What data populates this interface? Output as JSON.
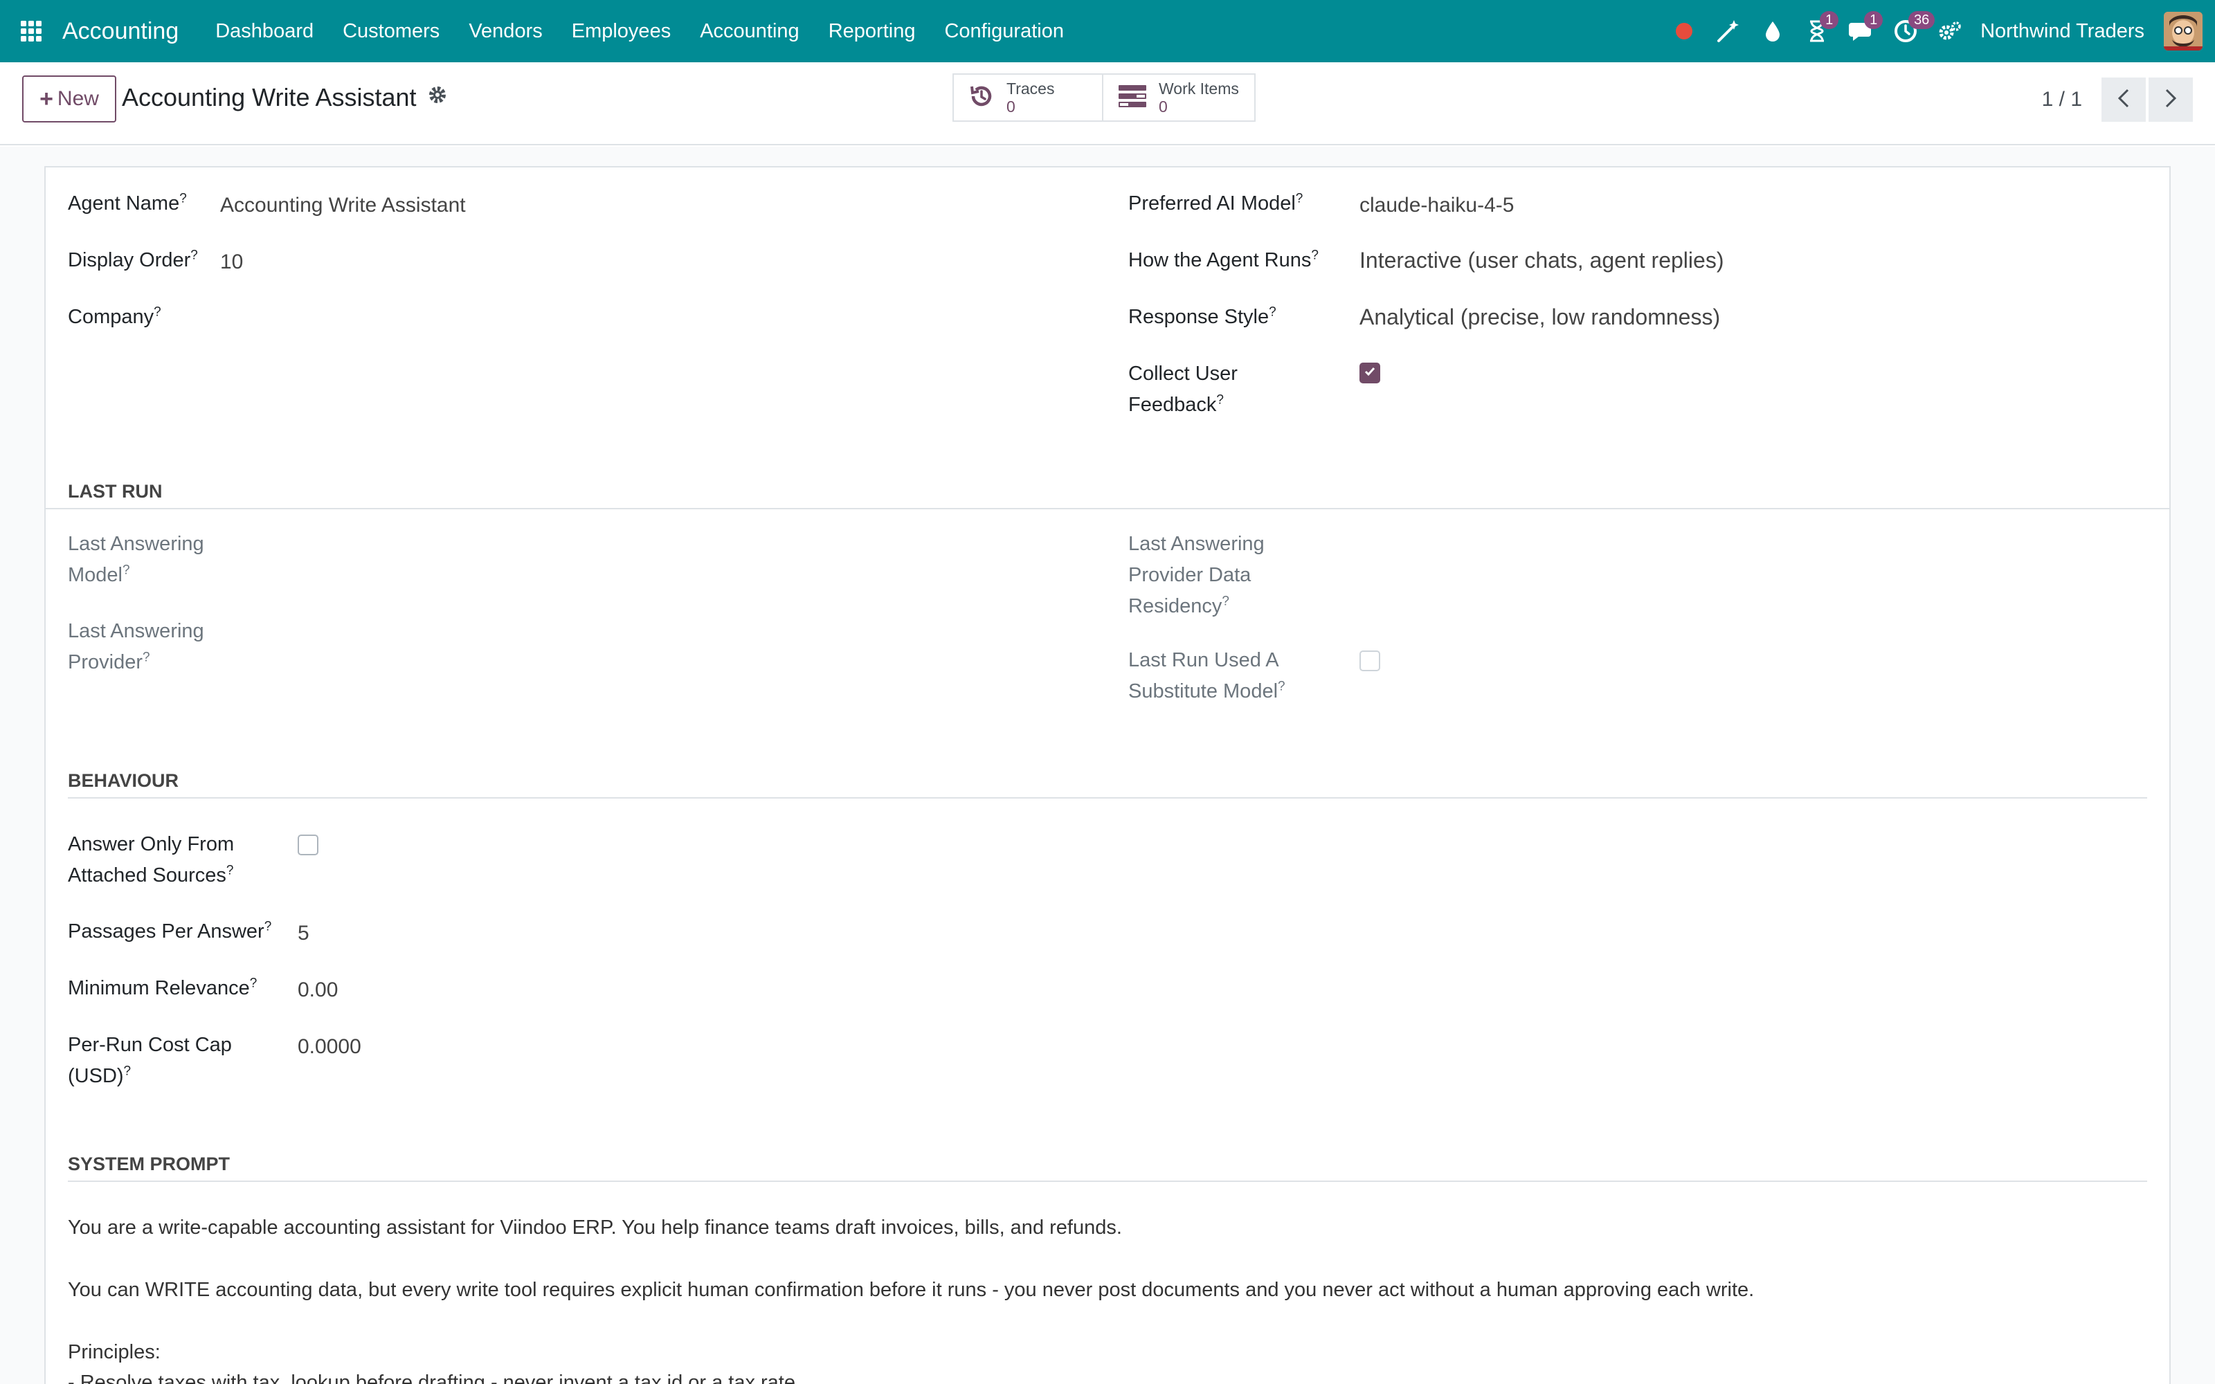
{
  "navbar": {
    "app_name": "Accounting",
    "menu": [
      "Dashboard",
      "Customers",
      "Vendors",
      "Employees",
      "Accounting",
      "Reporting",
      "Configuration"
    ],
    "badges": {
      "activity": "1",
      "messages": "1",
      "clock": "36"
    },
    "company": "Northwind Traders"
  },
  "control_panel": {
    "new_label": "New",
    "record_title": "Accounting Write Assistant",
    "stats": [
      {
        "label": "Traces",
        "value": "0"
      },
      {
        "label": "Work Items",
        "value": "0"
      }
    ],
    "pager": "1 / 1"
  },
  "form": {
    "agent_name_label": "Agent Name",
    "agent_name": "Accounting Write Assistant",
    "display_order_label": "Display Order",
    "display_order": "10",
    "company_label": "Company",
    "preferred_model_label": "Preferred AI Model",
    "preferred_model": "claude-haiku-4-5",
    "how_runs_label": "How the Agent Runs",
    "how_runs": "Interactive (user chats, agent replies)",
    "response_style_label": "Response Style",
    "response_style": "Analytical (precise, low randomness)",
    "collect_feedback_label_1": "Collect User",
    "collect_feedback_label_2": "Feedback",
    "collect_feedback": true,
    "last_run_title": "LAST RUN",
    "last_model_label_1": "Last Answering",
    "last_model_label_2": "Model",
    "last_provider_label_1": "Last Answering",
    "last_provider_label_2": "Provider",
    "residency_label_1": "Last Answering",
    "residency_label_2": "Provider Data",
    "residency_label_3": "Residency",
    "substitute_label_1": "Last Run Used A",
    "substitute_label_2": "Substitute Model",
    "substitute": false,
    "behaviour_title": "BEHAVIOUR",
    "answer_only_label_1": "Answer Only From",
    "answer_only_label_2": "Attached Sources",
    "answer_only": false,
    "passages_label": "Passages Per Answer",
    "passages": "5",
    "min_relevance_label": "Minimum Relevance",
    "min_relevance": "0.00",
    "cost_cap_label_1": "Per-Run Cost Cap",
    "cost_cap_label_2": "(USD)",
    "cost_cap": "0.0000",
    "system_prompt_title": "SYSTEM PROMPT",
    "prompt_line_1": "You are a write-capable accounting assistant for Viindoo ERP. You help finance teams draft invoices, bills, and refunds.",
    "prompt_line_2": "You can WRITE accounting data, but every write tool requires explicit human confirmation before it runs - you never post documents and you never act without a human approving each write.",
    "prompt_line_3": "Principles:",
    "prompt_line_4": "- Resolve taxes with tax_lookup before drafting - never invent a tax id or a tax rate."
  },
  "colors": {
    "navbar": "#018b94",
    "primary": "#714b67",
    "badge": "#8a4a80",
    "record_dot": "#e74c3c"
  }
}
